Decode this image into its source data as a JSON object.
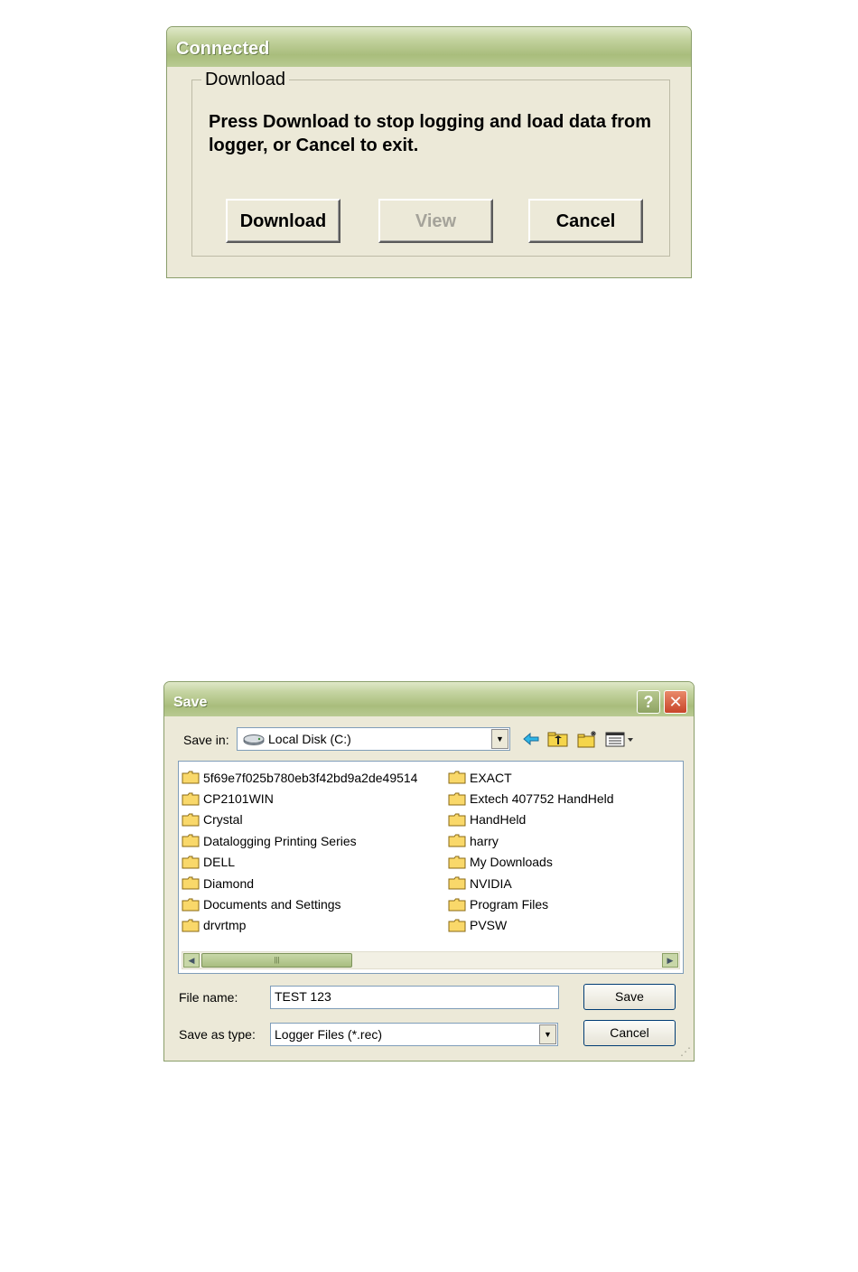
{
  "connected_dialog": {
    "title": "Connected",
    "group_label": "Download",
    "message": "Press Download to stop logging and load data from logger, or Cancel to exit.",
    "buttons": {
      "download": "Download",
      "view": "View",
      "cancel": "Cancel"
    }
  },
  "save_dialog": {
    "title": "Save",
    "help_glyph": "?",
    "close_glyph": "✕",
    "save_in_label": "Save in:",
    "save_in_value": "Local Disk (C:)",
    "toolbar_icons": [
      "back-icon",
      "up-folder-icon",
      "new-folder-icon",
      "view-menu-icon"
    ],
    "folders_left": [
      "5f69e7f025b780eb3f42bd9a2de49514",
      "CP2101WIN",
      "Crystal",
      "Datalogging Printing Series",
      "DELL",
      "Diamond",
      "Documents and Settings",
      "drvrtmp"
    ],
    "folders_right": [
      "EXACT",
      "Extech 407752 HandHeld",
      "HandHeld",
      "harry",
      "My Downloads",
      "NVIDIA",
      "Program Files",
      "PVSW"
    ],
    "file_name_label": "File name:",
    "file_name_value": "TEST 123",
    "save_type_label": "Save as type:",
    "save_type_value": "Logger Files (*.rec)",
    "save_button": "Save",
    "cancel_button": "Cancel"
  }
}
